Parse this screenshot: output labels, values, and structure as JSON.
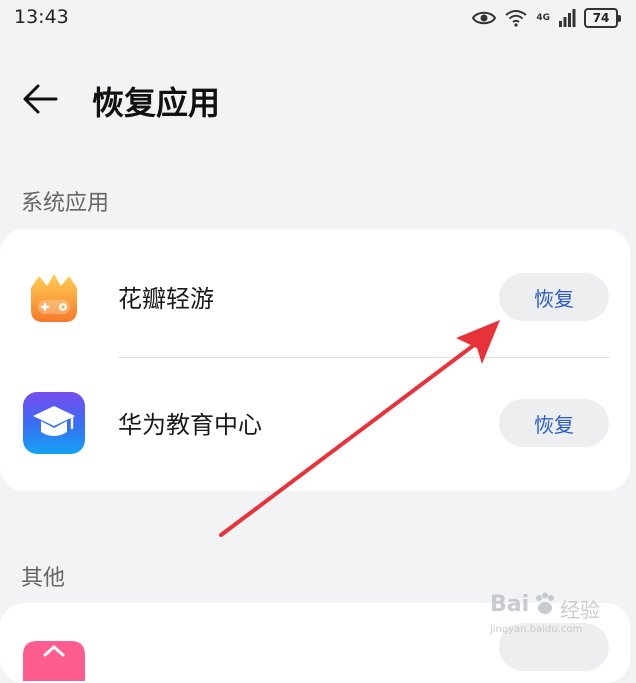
{
  "status_bar": {
    "time": "13:43",
    "network": "4G",
    "battery": "74",
    "icons": [
      "eye-icon",
      "wifi-icon",
      "signal-icon",
      "battery-icon"
    ]
  },
  "header": {
    "back_icon": "arrow-left-icon",
    "title": "恢复应用"
  },
  "sections": {
    "system": {
      "label": "系统应用",
      "apps": [
        {
          "name": "花瓣轻游",
          "action": "恢复",
          "icon": "game-pad-icon",
          "icon_color": "#f5a623"
        },
        {
          "name": "华为教育中心",
          "action": "恢复",
          "icon": "graduation-cap-icon",
          "icon_color": "#1f7ef0"
        }
      ]
    },
    "other": {
      "label": "其他",
      "apps": [
        {
          "name": "",
          "action": "",
          "icon": "app-icon-pink",
          "icon_color": "#ff5d8f"
        }
      ]
    }
  },
  "annotation": {
    "type": "red-arrow",
    "color": "#e8323a"
  },
  "watermark": {
    "brand": "Bai",
    "brand_suffix": "经验",
    "url": "jingyan.baidu.com"
  }
}
